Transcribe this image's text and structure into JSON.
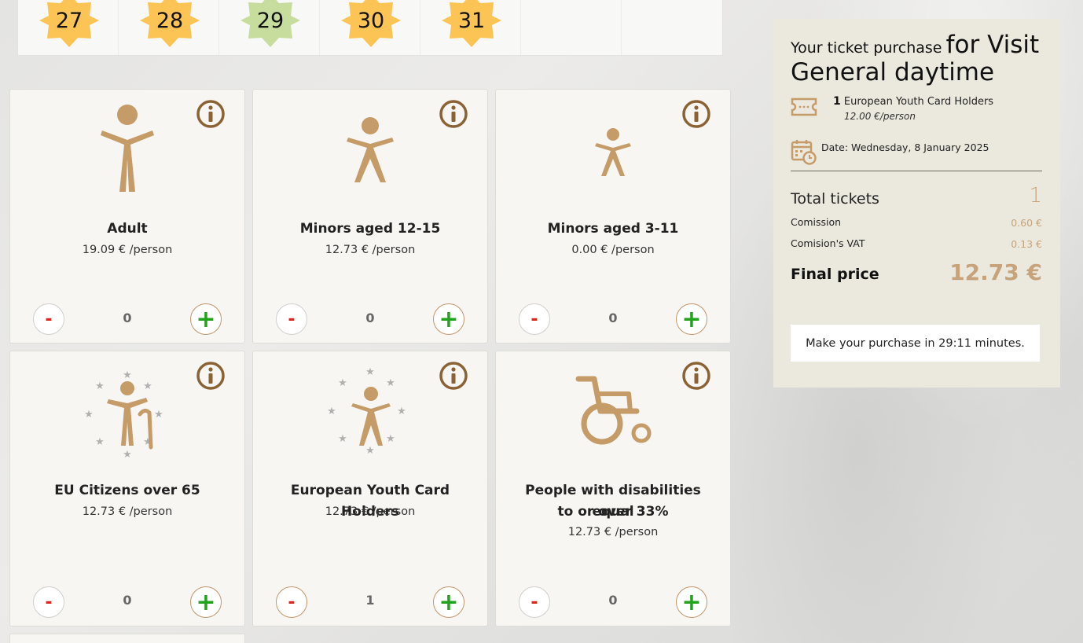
{
  "calendar": {
    "days": [
      {
        "num": "27",
        "color": "#fcc455"
      },
      {
        "num": "28",
        "color": "#fcc455"
      },
      {
        "num": "29",
        "color": "#c6dd9e"
      },
      {
        "num": "30",
        "color": "#fcc455"
      },
      {
        "num": "31",
        "color": "#fcc455"
      },
      {
        "num": "",
        "color": ""
      },
      {
        "num": "",
        "color": ""
      }
    ]
  },
  "tickets": [
    {
      "name": "Adult",
      "price": "19.09 € /person",
      "qty": "0",
      "icon": "adult-icon"
    },
    {
      "name": "Minors aged 12-15",
      "price": "12.73 € /person",
      "qty": "0",
      "icon": "teen-icon"
    },
    {
      "name": "Minors aged 3-11",
      "price": "0.00 € /person",
      "qty": "0",
      "icon": "child-icon"
    },
    {
      "name": "EU Citizens over 65",
      "price": "12.73 € /person",
      "qty": "0",
      "icon": "senior-eu-icon"
    },
    {
      "name": "European Youth Card Holders",
      "price": "12.73 € /person",
      "qty": "1",
      "icon": "youth-eu-icon"
    },
    {
      "name_line1": "People with disabilities equal",
      "name_line2": "to or over 33%",
      "price": "12.73 € /person",
      "qty": "0",
      "icon": "wheelchair-icon"
    }
  ],
  "buttons": {
    "minus": "-",
    "plus": "+"
  },
  "summary": {
    "title_pre": "Your ticket purchase",
    "title_big1": "for Visit",
    "title_big2": "General daytime",
    "ticket_qty": "1",
    "ticket_name": "European Youth Card Holders",
    "ticket_unit": "12.00 €/person",
    "date": "Date: Wednesday, 8 January 2025",
    "total_label": "Total tickets",
    "total_value": "1",
    "commission_label": "Comission",
    "commission_value": "0.60 €",
    "vat_label": "Comision's VAT",
    "vat_value": "0.13 €",
    "final_label": "Final price",
    "final_value": "12.73 €",
    "timer": "Make your purchase in 29:11 minutes."
  },
  "colors": {
    "accent": "#c4956a",
    "figure": "#c59b68",
    "info": "#8a6234",
    "minus": "#e0221b",
    "plus": "#22a31e",
    "star": "#b0b0b0"
  }
}
